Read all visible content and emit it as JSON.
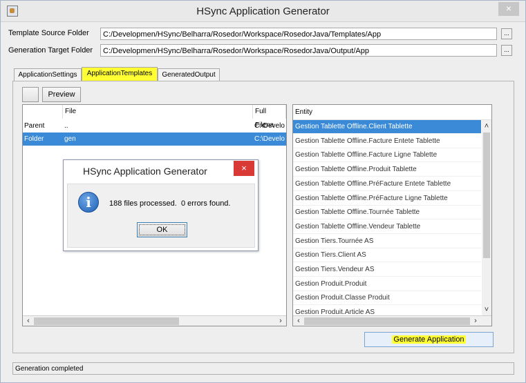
{
  "window": {
    "title": "HSync Application Generator",
    "close_glyph": "×"
  },
  "paths": {
    "template_label": "Template Source Folder",
    "template_value": "C:/Developmen/HSync/Belharra/Rosedor/Workspace/RosedorJava/Templates/App",
    "target_label": "Generation Target Folder",
    "target_value": "C:/Developmen/HSync/Belharra/Rosedor/Workspace/RosedorJava/Output/App",
    "browse_label": "..."
  },
  "tabs": [
    {
      "label": "ApplicationSettings",
      "active": false
    },
    {
      "label": "ApplicationTemplates",
      "active": true
    },
    {
      "label": "GeneratedOutput",
      "active": false
    }
  ],
  "toolbar": {
    "preview_label": "Preview"
  },
  "file_table": {
    "columns": [
      "",
      "File",
      "Full Filena"
    ],
    "rows": [
      {
        "type": "Parent",
        "file": "..",
        "full": "C:\\Develo",
        "selected": false
      },
      {
        "type": "Folder",
        "file": "gen",
        "full": "C:\\Develo",
        "selected": true
      }
    ]
  },
  "entity_list": {
    "header": "Entity",
    "items": [
      "Gestion Tablette Offline.Client Tablette",
      "Gestion Tablette Offline.Facture Entete Tablette",
      "Gestion Tablette Offline.Facture Ligne Tablette",
      "Gestion Tablette Offline.Produit Tablette",
      "Gestion Tablette Offline.PréFacture Entete Tablette",
      "Gestion Tablette Offline.PréFacture Ligne Tablette",
      "Gestion Tablette Offline.Tournée Tablette",
      "Gestion Tablette Offline.Vendeur Tablette",
      "Gestion Tiers.Tournée AS",
      "Gestion Tiers.Client AS",
      "Gestion Tiers.Vendeur AS",
      "Gestion Produit.Produit",
      "Gestion Produit.Classe Produit",
      "Gestion Produit.Article AS"
    ],
    "selected_index": 0
  },
  "generate_button": "Generate Application",
  "status": "Generation completed",
  "dialog": {
    "title": "HSync Application Generator",
    "message": "188 files processed.  0 errors found.",
    "ok_label": "OK",
    "close_glyph": "×",
    "icon": "info-icon"
  },
  "colors": {
    "highlight": "#ffff33",
    "selection": "#3a8ad8",
    "dialog_close": "#d93a36"
  }
}
